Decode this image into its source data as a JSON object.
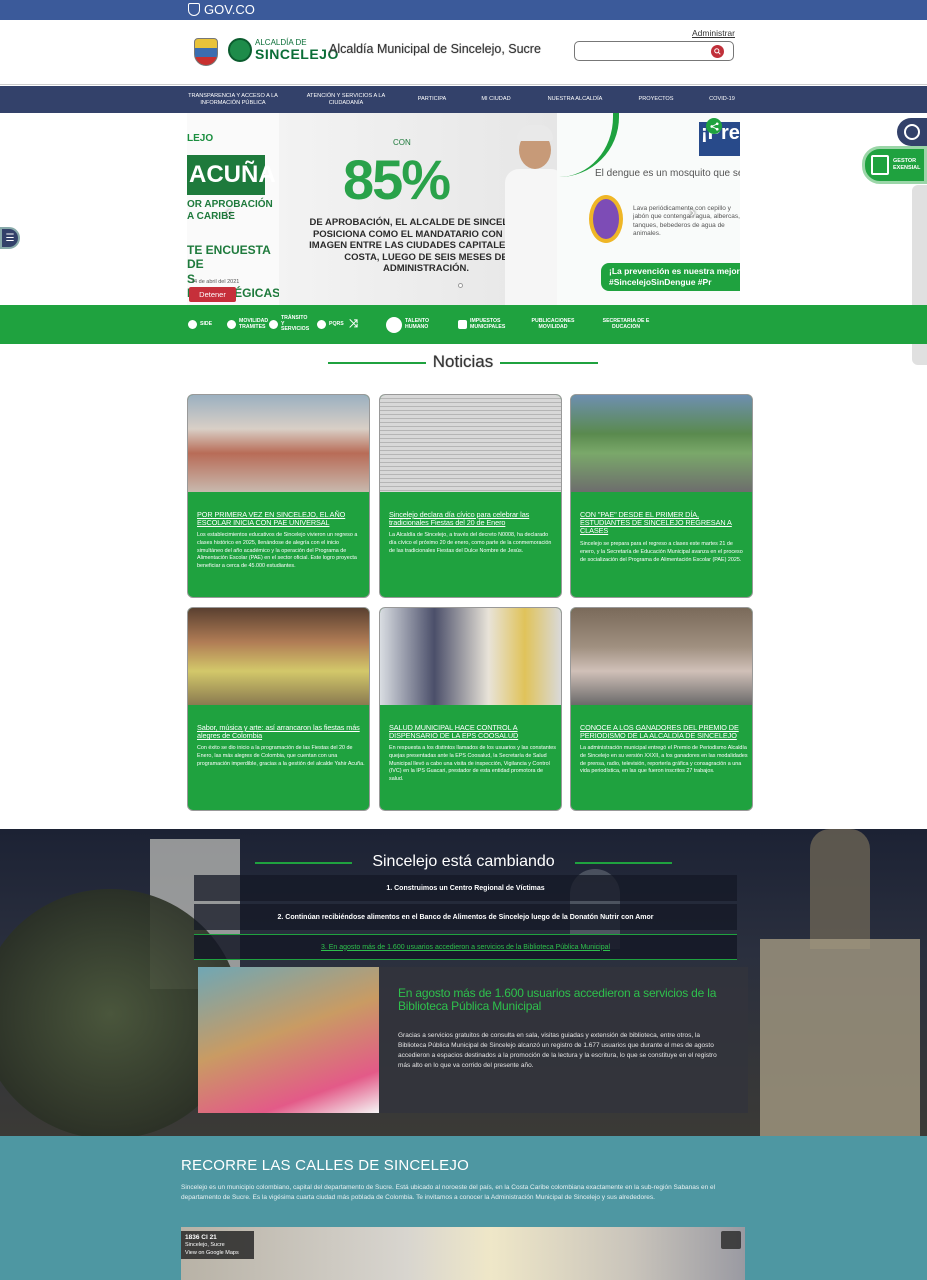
{
  "gov": {
    "logo_text": "GOV.CO"
  },
  "header": {
    "logo_line1": "ALCALDÍA DE",
    "logo_line2": "SINCELEJO",
    "site_title": "Alcaldía Municipal de Sincelejo, Sucre",
    "admin_link": "Administrar",
    "search_placeholder": ""
  },
  "nav": {
    "items": [
      "TRANSPARENCIA Y ACCESO A LA INFORMACIÓN PÚBLICA",
      "ATENCIÓN Y SERVICIOS A LA CIUDADANÍA",
      "PARTICIPA",
      "MI CIUDAD",
      "NUESTRA ALCALDÍA",
      "PROYECTOS",
      "COVID-19"
    ]
  },
  "carousel": {
    "left_slide": {
      "partial_name": "LEJO",
      "headline": "ACUÑA",
      "line1": "OR APROBACIÓN",
      "line2": "A CARIBE",
      "line3": "TE ENCUESTA DE",
      "line4": "S ESTRATÉGICAS.",
      "date": "14 de abril del 2021"
    },
    "mid_slide": {
      "con": "CON",
      "percent": "85%",
      "body": "DE APROBACIÓN, EL ALCALDE DE SINCELEJO SE POSICIONA COMO EL MANDATARIO CON MEJOR IMAGEN ENTRE LAS CIUDADES CAPITALES DE LA COSTA, LUEGO DE SEIS MESES DE ADMINISTRACIÓN."
    },
    "right_slide": {
      "badge": "¡Pre",
      "subtitle": "El dengue es un mosquito que se r",
      "tips": "Lava periódicamente con cepillo y jabón que contengan agua, albercas, tanques, bebederos de agua de animales.",
      "banner_line1": "¡La prevención es nuestra mejor",
      "banner_line2": "#SincelejoSinDengue #Pr"
    },
    "stop_button": "Detener"
  },
  "widgets": {
    "gestor_line1": "GESTOR",
    "gestor_line2": "EXENSIAL",
    "menu_icon": "☰"
  },
  "quicklinks": [
    "SIDE",
    "MOVILIDAD TRAMITES",
    "TRÁNSITO Y SERVICIOS",
    "PQRS",
    "TALENTO HUMANO",
    "IMPUESTOS MUNICIPALES",
    "PUBLICACIONES MOVILIDAD",
    "SECRETARIA DE E DUCACION"
  ],
  "news": {
    "section_title": "Noticias",
    "cards": [
      {
        "title": "POR PRIMERA VEZ EN SINCELEJO, EL AÑO ESCOLAR INICIA CON PAE UNIVERSAL",
        "text": "Los establecimientos educativos de Sincelejo vivieron un regreso a clases histórico en 2025, llenándose de alegría con el inicio simultáneo del año académico y la operación del Programa de Alimentación Escolar (PAE) en el sector oficial. Este logro proyecta beneficiar a cerca de 45.000 estudiantes."
      },
      {
        "title": "Sincelejo declara día cívico para celebrar las tradicionales Fiestas del 20 de Enero",
        "text": "La Alcaldía de Sincelejo, a través del decreto N0008, ha declarado día cívico el próximo 20 de enero, como parte de la conmemoración de las tradicionales Fiestas del Dulce Nombre de Jesús."
      },
      {
        "title": "CON \"PAE\" DESDE EL PRIMER DÍA, ESTUDIANTES DE SINCELEJO REGRESAN A CLASES",
        "text": "Sincelejo se prepara para el regreso a clases este martes 21 de enero, y la Secretaría de Educación Municipal avanza en el proceso de socialización del Programa de Alimentación Escolar (PAE) 2025."
      },
      {
        "title": "Sabor, música y arte: así arrancaron las fiestas más alegres de Colombia",
        "text": "Con éxito se dio inicio a la programación de las Fiestas del 20 de Enero, las más alegres de Colombia, que cuentan con una programación imperdible, gracias a la gestión del alcalde Yahir Acuña."
      },
      {
        "title": "SALUD MUNICIPAL HACE CONTROL A DISPENSARIO DE LA EPS COOSALUD",
        "text": "En respuesta a los distintos llamados de los usuarios y las constantes quejas presentadas ante la EPS Coosalud, la Secretaría de Salud Municipal llevó a cabo una visita de inspección, Vigilancia y Control (IVC) en la IPS Guacari, prestador de esta entidad promotora de salud."
      },
      {
        "title": "CONOCE A LOS GANADORES DEL PREMIO DE PERIODISMO DE LA ALCALDÍA DE SINCELEJO",
        "text": "La administración municipal entregó el Premio de Periodismo Alcaldía de Sincelejo en su versión XXXII, a los ganadores en las modalidades de prensa, radio, televisión, reportería gráfica y consagración a una vida periodística, en las que fueron inscritos 27 trabajos."
      }
    ]
  },
  "cambio": {
    "title": "Sincelejo está cambiando",
    "items": [
      "1. Construimos un Centro Regional de Víctimas",
      "2. Continúan recibiéndose alimentos en el Banco de Alimentos de Sincelejo luego de la Donatón Nutrir con Amor",
      "3. En agosto más de 1.600 usuarios accedieron a servicios de la Biblioteca Pública Municipal"
    ],
    "feature_title": "En agosto más de 1.600 usuarios accedieron a servicios de la Biblioteca Pública Municipal",
    "feature_body": "Gracias a servicios gratuitos de consulta en sala, visitas guiadas y extensión de biblioteca, entre otros, la Biblioteca Pública Municipal de Sincelejo alcanzó un registro de 1.677 usuarios que durante el mes de agosto accedieron a espacios destinados a la promoción de la lectura y la escritura, lo que se constituye en el registro más alto en lo que va corrido del presente año."
  },
  "recorre": {
    "title": "RECORRE LAS CALLES DE SINCELEJO",
    "text": "Sincelejo es un municipio colombiano, capital del departamento de Sucre. Está ubicado al noroeste del país, en la Costa Caribe colombiana exactamente en la sub-región Sabanas en el departamento de Sucre. Es la vigésima cuarta ciudad más poblada de Colombia. Te invitamos a conocer la Administración Municipal de Sincelejo y sus alrededores.",
    "map_address": "1836 Cl 21",
    "map_city": "Sincelejo, Sucre",
    "map_link": "View on Google Maps"
  }
}
